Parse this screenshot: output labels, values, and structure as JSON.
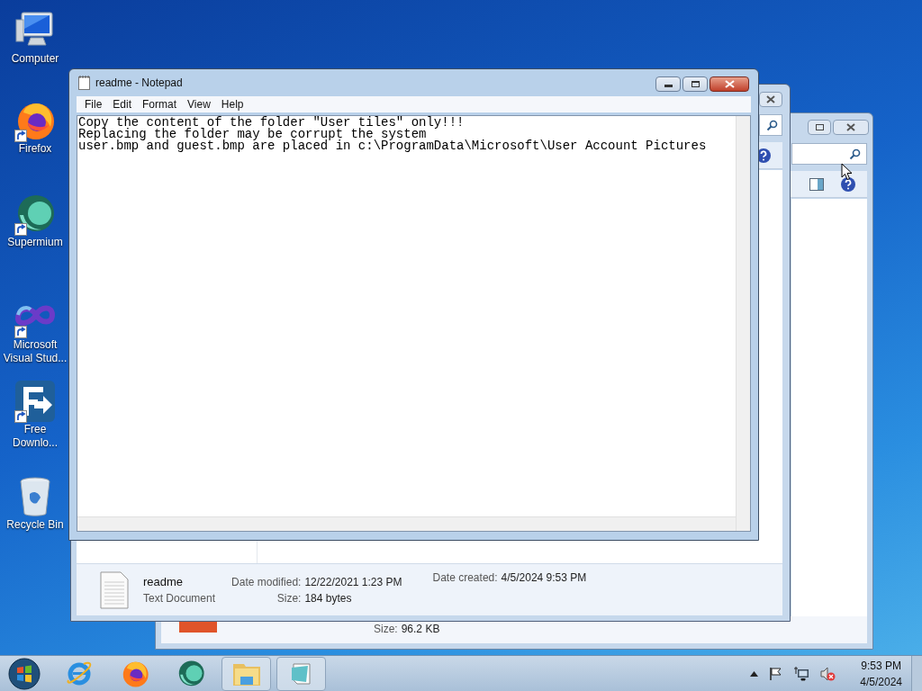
{
  "desktop_icons": [
    {
      "kind": "computer",
      "label": "Computer"
    },
    {
      "kind": "firefox",
      "label": "Firefox"
    },
    {
      "kind": "supermium",
      "label": "Supermium"
    },
    {
      "kind": "vstudio",
      "label": "Microsoft Visual Stud..."
    },
    {
      "kind": "download",
      "label": "Free Downlo..."
    },
    {
      "kind": "recycle",
      "label": "Recycle Bin"
    }
  ],
  "explorer_back": {
    "size_label": "Size:",
    "size": "96.2 KB"
  },
  "explorer_front": {
    "details": {
      "name": "readme",
      "type": "Text Document",
      "fields": [
        {
          "label": "Date modified:",
          "value": "12/22/2021 1:23 PM"
        },
        {
          "label": "Date created:",
          "value": "4/5/2024 9:53 PM"
        },
        {
          "label": "Size:",
          "value": "184 bytes"
        }
      ]
    }
  },
  "notepad": {
    "title": "readme - Notepad",
    "menu": [
      "File",
      "Edit",
      "Format",
      "View",
      "Help"
    ],
    "lines": [
      "Copy the content of the folder \"User tiles\" only!!!",
      "Replacing the folder may be corrupt the system",
      "user.bmp and guest.bmp are placed in c:\\ProgramData\\Microsoft\\User Account Pictures"
    ]
  },
  "taskbar": {
    "items": [
      {
        "kind": "ie"
      },
      {
        "kind": "firefox"
      },
      {
        "kind": "supermium"
      },
      {
        "kind": "explorer"
      },
      {
        "kind": "notepad"
      }
    ],
    "time": "9:53 PM",
    "date": "4/5/2024"
  }
}
